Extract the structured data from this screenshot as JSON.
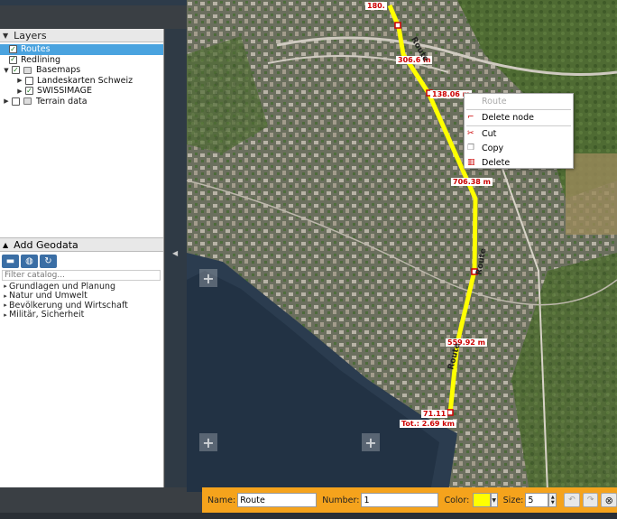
{
  "layers_panel": {
    "title": "Layers",
    "items": [
      {
        "label": "Routes",
        "checked": true,
        "selected": true
      },
      {
        "label": "Redlining",
        "checked": true
      },
      {
        "label": "Basemaps",
        "checked": true
      },
      {
        "label": "Landeskarten Schweiz",
        "checked": false
      },
      {
        "label": "SWISSIMAGE",
        "checked": true
      },
      {
        "label": "Terrain data",
        "checked": false
      }
    ]
  },
  "geodata_panel": {
    "title": "Add Geodata",
    "filter_placeholder": "Filter catalog...",
    "categories": [
      "Grundlagen und Planung",
      "Natur und Umwelt",
      "Bevölkerung und Wirtschaft",
      "Militär, Sicherheit"
    ]
  },
  "context_menu": {
    "title": "Route",
    "items": [
      {
        "label": "Delete node",
        "icon": "delete-node-icon"
      },
      {
        "label": "Cut",
        "icon": "scissors-icon"
      },
      {
        "label": "Copy",
        "icon": "copy-icon"
      },
      {
        "label": "Delete",
        "icon": "trash-icon"
      }
    ]
  },
  "route_labels": {
    "seg1": "180.",
    "seg2": "306.6 m",
    "seg3": "138.06 m",
    "seg4": "706.38 m",
    "seg5": "559.92 m",
    "seg6": "71.11",
    "total": "Tot.: 2.69 km",
    "route_name_a": "Route",
    "route_name_b": "Route",
    "route_name_c": "Route"
  },
  "toolbar": {
    "name_label": "Name:",
    "name_value": "Route",
    "number_label": "Number:",
    "number_value": "1",
    "color_label": "Color:",
    "color_value": "#ffff00",
    "size_label": "Size:",
    "size_value": "5"
  },
  "splitter_text": "ᴧ",
  "colors": {
    "route": "#ffff00",
    "accent": "#f5a31c",
    "selection": "#4aa3df"
  }
}
